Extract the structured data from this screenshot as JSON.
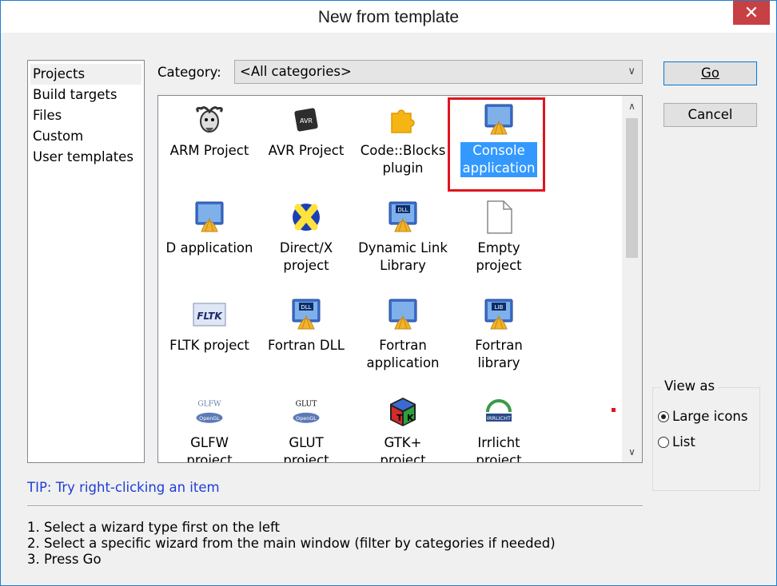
{
  "window": {
    "title": "New from template",
    "close_symbol": "✕"
  },
  "left_list": {
    "items": [
      "Projects",
      "Build targets",
      "Files",
      "Custom",
      "User templates"
    ],
    "selected": "Projects"
  },
  "category": {
    "label": "Category:",
    "value": "<All categories>"
  },
  "templates": [
    {
      "lines": [
        "ARM Project"
      ],
      "icon": "gnu-icon"
    },
    {
      "lines": [
        "AVR Project"
      ],
      "icon": "avr-chip-icon"
    },
    {
      "lines": [
        "Code::Blocks",
        "plugin"
      ],
      "icon": "puzzle-plugin-icon"
    },
    {
      "lines": [
        "Console",
        "application"
      ],
      "icon": "console-app-icon",
      "selected": true
    },
    {
      "lines": [
        "D application"
      ],
      "icon": "d-app-icon"
    },
    {
      "lines": [
        "Direct/X",
        "project"
      ],
      "icon": "directx-icon"
    },
    {
      "lines": [
        "Dynamic Link",
        "Library"
      ],
      "icon": "dll-icon",
      "badge": "DLL"
    },
    {
      "lines": [
        "Empty",
        "project"
      ],
      "icon": "empty-file-icon"
    },
    {
      "lines": [
        "FLTK project"
      ],
      "icon": "fltk-icon",
      "badge": "FLTK"
    },
    {
      "lines": [
        "Fortran DLL"
      ],
      "icon": "fortran-dll-icon",
      "badge": "DLL"
    },
    {
      "lines": [
        "Fortran",
        "application"
      ],
      "icon": "fortran-app-icon"
    },
    {
      "lines": [
        "Fortran",
        "library"
      ],
      "icon": "fortran-lib-icon",
      "badge": "LIB"
    },
    {
      "lines": [
        "GLFW",
        "project"
      ],
      "icon": "glfw-icon",
      "badge": "GLFW",
      "sub": "OpenGL"
    },
    {
      "lines": [
        "GLUT",
        "project"
      ],
      "icon": "glut-icon",
      "badge": "GLUT",
      "sub": "OpenGL"
    },
    {
      "lines": [
        "GTK+",
        "project"
      ],
      "icon": "gtk-icon"
    },
    {
      "lines": [
        "Irrlicht",
        "project"
      ],
      "icon": "irrlicht-icon",
      "badge": "IRRLICHT"
    }
  ],
  "buttons": {
    "go": "Go",
    "cancel": "Cancel"
  },
  "view_as": {
    "legend": "View as",
    "options": [
      "Large icons",
      "List"
    ],
    "selected": "Large icons"
  },
  "tip": "TIP: Try right-clicking an item",
  "instructions": [
    "1. Select a wizard type first on the left",
    "2. Select a specific wizard from the main window (filter by categories if needed)",
    "3. Press Go"
  ],
  "colors": {
    "selection": "#3399ff",
    "highlight_frame": "#e0141e",
    "tip_text": "#1e3dd6",
    "close_button": "#c74043"
  }
}
